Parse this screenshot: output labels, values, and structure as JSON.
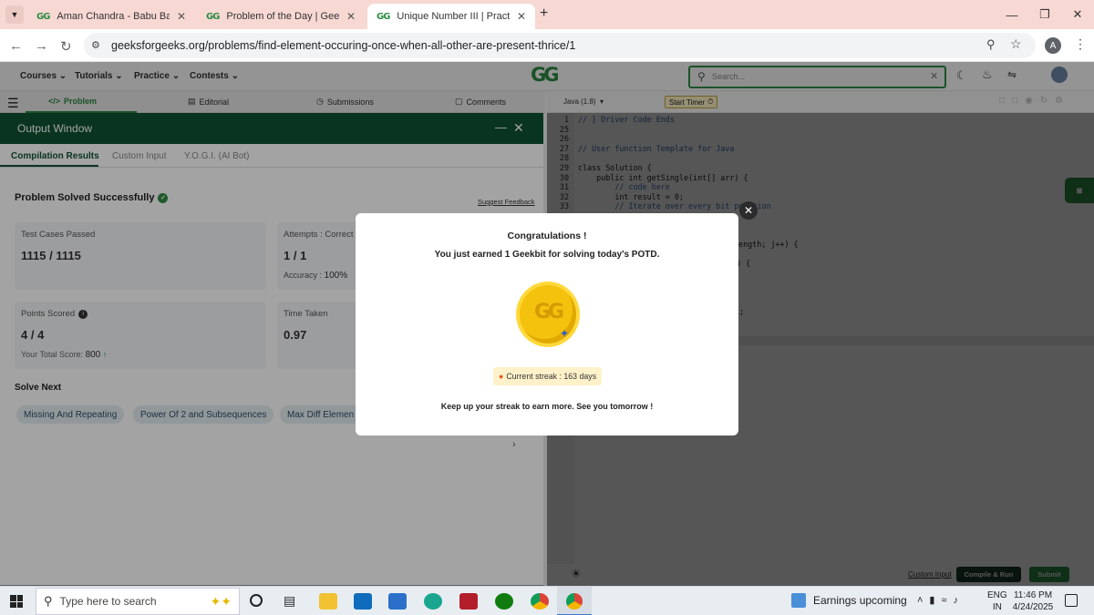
{
  "browser": {
    "tabs": [
      {
        "title": "Aman Chandra - Babu Banarasi",
        "active": false
      },
      {
        "title": "Problem of the Day | GeeksforG",
        "active": false
      },
      {
        "title": "Unique Number III | Practice | G",
        "active": true
      }
    ],
    "url": "geeksforgeeks.org/problems/find-element-occuring-once-when-all-other-are-present-thrice/1",
    "profile_initial": "A"
  },
  "site_header": {
    "nav": [
      "Courses",
      "Tutorials",
      "Practice",
      "Contests"
    ],
    "logo": "GG",
    "search_placeholder": "Search..."
  },
  "problem_tabs": {
    "problem": "Problem",
    "editorial": "Editorial",
    "submissions": "Submissions",
    "comments": "Comments"
  },
  "editor": {
    "language": "Java (1.8)",
    "start_timer": "Start Timer",
    "line_numbers": [
      "1",
      "25",
      "26",
      "27",
      "28",
      "29",
      "30",
      "31",
      "32",
      "33"
    ],
    "code_lines": [
      "// } Driver Code Ends",
      "",
      "",
      "// User function Template for Java",
      "",
      "class Solution {",
      "    public int getSingle(int[] arr) {",
      "        // code here",
      "        int result = 0;",
      "        // Iterate over every bit position"
    ],
    "partial_lines": [
      "length; j++) {",
      ") {",
      "k;"
    ],
    "custom_input": "Custom Input",
    "compile_run": "Compile & Run",
    "submit": "Submit"
  },
  "output_window": {
    "title": "Output Window",
    "tabs": [
      "Compilation Results",
      "Custom Input",
      "Y.O.G.I. (AI Bot)"
    ],
    "status": "Problem Solved Successfully",
    "suggest_feedback": "Suggest Feedback",
    "test_cases_label": "Test Cases Passed",
    "test_cases_value": "1115 / 1115",
    "attempts_label": "Attempts : Correct /",
    "attempts_value": "1 / 1",
    "accuracy_label": "Accuracy :",
    "accuracy_value": "100%",
    "points_label": "Points Scored",
    "points_value": "4 / 4",
    "total_score_label": "Your Total Score:",
    "total_score_value": "800",
    "time_label": "Time Taken",
    "time_value": "0.97",
    "solve_next_title": "Solve Next",
    "solve_next": [
      "Missing And Repeating",
      "Power Of 2 and Subsequences",
      "Max Diff Elemen"
    ]
  },
  "modal": {
    "title": "Congratulations !",
    "message": "You just earned 1 Geekbit for solving today's POTD.",
    "coin_logo": "GG",
    "streak": "Current streak : 163 days",
    "footer": "Keep up your streak to earn more. See you tomorrow !"
  },
  "taskbar": {
    "search_placeholder": "Type here to search",
    "widget": "Earnings upcoming",
    "lang_top": "ENG",
    "lang_bottom": "IN",
    "time": "11:46 PM",
    "date": "4/24/2025"
  },
  "colors": {
    "gfg_green": "#2f8d46",
    "output_header": "#0f5233",
    "coin_gold": "#f4c20d"
  }
}
